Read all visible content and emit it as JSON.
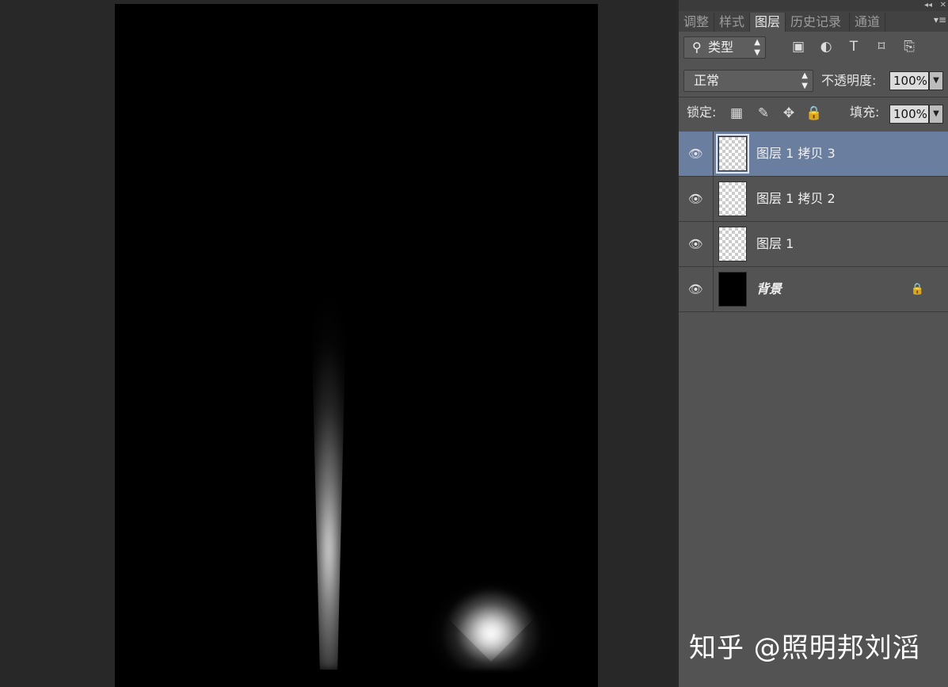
{
  "panel": {
    "tabs": [
      {
        "label": "调整",
        "active": false
      },
      {
        "label": "样式",
        "active": false
      },
      {
        "label": "图层",
        "active": true
      },
      {
        "label": "历史记录",
        "active": false
      },
      {
        "label": "通道",
        "active": false
      }
    ],
    "collapse_glyph": "◂◂",
    "close_glyph": "✕",
    "menu_glyph": "▾≡",
    "filter": {
      "label": "类型",
      "icon": "search-icon"
    },
    "filter_icons": [
      "image-filter-icon",
      "adjustment-filter-icon",
      "type-filter-icon",
      "shape-filter-icon",
      "smart-object-filter-icon"
    ],
    "blend_mode": "正常",
    "opacity_label": "不透明度:",
    "opacity_value": "100%",
    "lock_label": "锁定:",
    "lock_icons": [
      "lock-transparent-icon",
      "lock-image-icon",
      "lock-position-icon",
      "lock-all-icon"
    ],
    "fill_label": "填充:",
    "fill_value": "100%"
  },
  "layers": [
    {
      "name": "图层 1 拷贝 3",
      "selected": true,
      "thumb": "transparent",
      "visible": true,
      "locked": false
    },
    {
      "name": "图层 1 拷贝 2",
      "selected": false,
      "thumb": "transparent",
      "visible": true,
      "locked": false
    },
    {
      "name": "图层 1",
      "selected": false,
      "thumb": "transparent",
      "visible": true,
      "locked": false
    },
    {
      "name": "背景",
      "selected": false,
      "thumb": "black",
      "visible": true,
      "locked": true
    }
  ],
  "watermark": "知乎 @照明邦刘滔",
  "colors": {
    "selected_layer": "#6a7ea0",
    "panel_bg": "#535353",
    "workspace_bg": "#282828"
  }
}
